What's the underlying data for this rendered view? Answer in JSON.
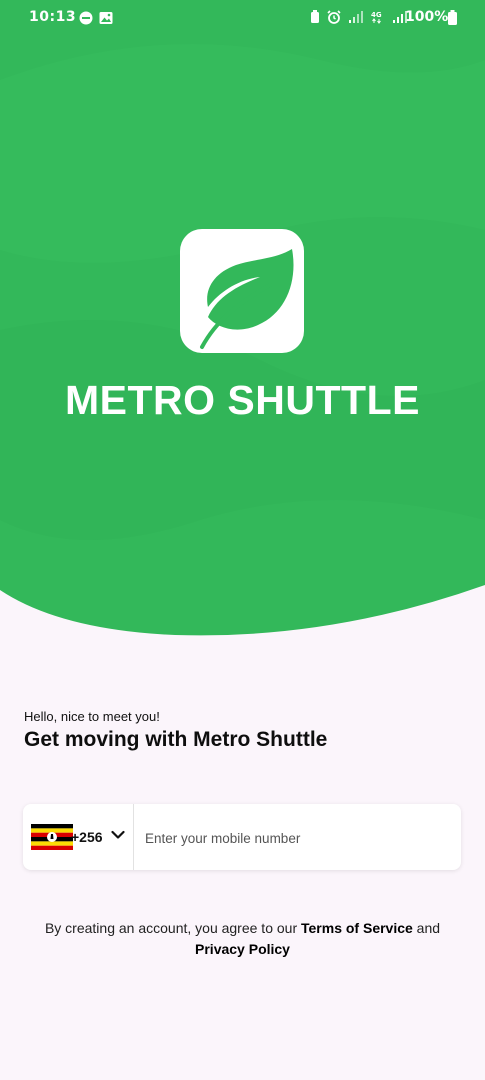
{
  "status_bar": {
    "time": "10:13",
    "battery": "100%"
  },
  "brand": {
    "name": "METRO SHUTTLE",
    "logo_icon": "leaf-icon",
    "color": "#33b85a"
  },
  "welcome": {
    "greeting": "Hello, nice to meet you!",
    "headline": "Get moving with Metro Shuttle"
  },
  "phone": {
    "country_flag": "uganda-flag-icon",
    "dial_code": "+256",
    "placeholder": "Enter your mobile number",
    "value": ""
  },
  "legal": {
    "prefix": "By creating an account, you agree to our ",
    "terms_link": "Terms of Service",
    "conjunction": " and ",
    "privacy_link": "Privacy Policy"
  }
}
